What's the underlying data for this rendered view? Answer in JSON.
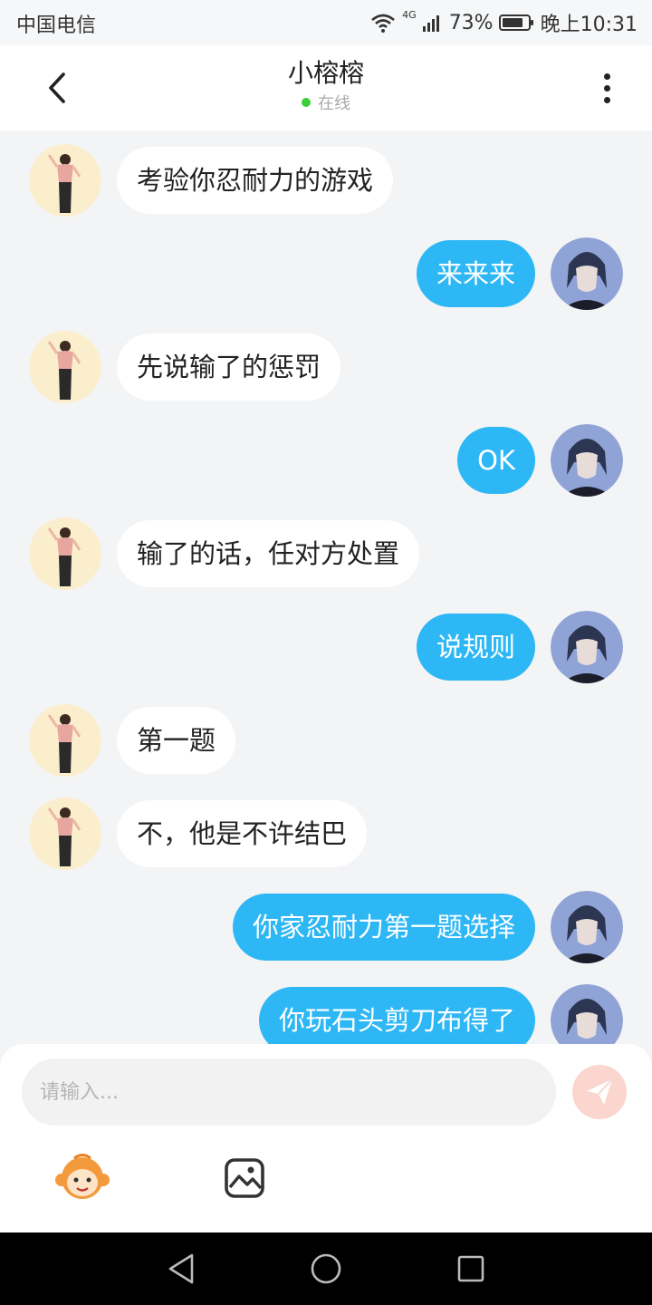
{
  "status_bar": {
    "carrier": "中国电信",
    "network": "4G",
    "battery": "73%",
    "time": "晚上10:31"
  },
  "header": {
    "title": "小榕榕",
    "status": "在线",
    "back_icon": "chevron-left-icon",
    "more_icon": "more-vertical-icon"
  },
  "messages": [
    {
      "side": "left",
      "text": "考验你忍耐力的游戏"
    },
    {
      "side": "right",
      "text": "来来来"
    },
    {
      "side": "left",
      "text": "先说输了的惩罚"
    },
    {
      "side": "right",
      "text": "OK"
    },
    {
      "side": "left",
      "text": "输了的话，任对方处置"
    },
    {
      "side": "right",
      "text": "说规则"
    },
    {
      "side": "left",
      "text": "第一题"
    },
    {
      "side": "left",
      "text": "不，他是不许结巴"
    },
    {
      "side": "right",
      "text": "你家忍耐力第一题选择"
    },
    {
      "side": "right",
      "text": "你玩石头剪刀布得了"
    }
  ],
  "composer": {
    "placeholder": "请输入...",
    "send_icon": "paper-plane-icon",
    "emoji_icon": "monkey-emoji-icon",
    "image_icon": "image-icon"
  },
  "colors": {
    "outgoing_bubble": "#2db7f5",
    "incoming_bubble": "#ffffff",
    "background": "#f3f4f6",
    "online": "#3ccf3c",
    "send_button": "#fbd6cf"
  }
}
